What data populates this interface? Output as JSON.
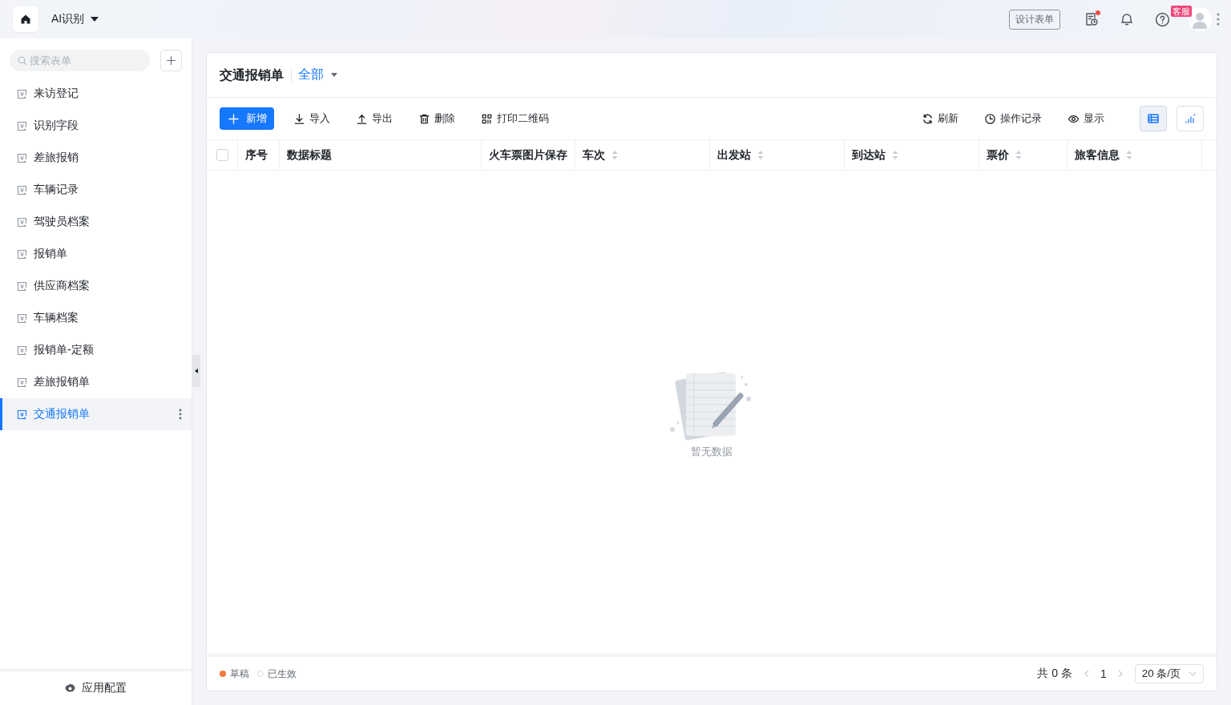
{
  "header": {
    "app_name": "AI识别",
    "design_button": "设计表单",
    "notification_dot": true,
    "support_badge": "客服"
  },
  "sidebar": {
    "search_placeholder": "搜索表单",
    "items": [
      {
        "label": "来访登记",
        "selected": false
      },
      {
        "label": "识别字段",
        "selected": false
      },
      {
        "label": "差旅报销",
        "selected": false
      },
      {
        "label": "车辆记录",
        "selected": false
      },
      {
        "label": "驾驶员档案",
        "selected": false
      },
      {
        "label": "报销单",
        "selected": false
      },
      {
        "label": "供应商档案",
        "selected": false
      },
      {
        "label": "车辆档案",
        "selected": false
      },
      {
        "label": "报销单-定额",
        "selected": false
      },
      {
        "label": "差旅报销单",
        "selected": false
      },
      {
        "label": "交通报销单",
        "selected": true
      }
    ],
    "footer": "应用配置"
  },
  "main": {
    "title": "交通报销单",
    "filter": "全部",
    "toolbar_left": [
      {
        "label": "新增",
        "kind": "add"
      },
      {
        "label": "导入",
        "kind": "import"
      },
      {
        "label": "导出",
        "kind": "export"
      },
      {
        "label": "删除",
        "kind": "delete"
      },
      {
        "label": "打印二维码",
        "kind": "qrcode"
      }
    ],
    "toolbar_right": [
      {
        "label": "刷新",
        "kind": "refresh"
      },
      {
        "label": "操作记录",
        "kind": "history"
      },
      {
        "label": "显示",
        "kind": "view"
      }
    ],
    "view_toggles": [
      {
        "kind": "table",
        "selected": true
      },
      {
        "kind": "chart",
        "selected": false
      }
    ],
    "table": {
      "select_all_checked": false,
      "columns": [
        {
          "label": "序号",
          "sortable": false
        },
        {
          "label": "数据标题",
          "sortable": false
        },
        {
          "label": "火车票图片保存",
          "sortable": false
        },
        {
          "label": "车次",
          "sortable": true
        },
        {
          "label": "出发站",
          "sortable": true
        },
        {
          "label": "到达站",
          "sortable": true
        },
        {
          "label": "票价",
          "sortable": true
        },
        {
          "label": "旅客信息",
          "sortable": true
        }
      ]
    },
    "empty_text": "暂无数据",
    "legend": [
      {
        "label": "草稿",
        "color": "#f07b3f",
        "filled": true
      },
      {
        "label": "已生效",
        "color": "#d9d9d9",
        "filled": false
      }
    ],
    "pagination": {
      "total": "共 0 条",
      "page": "1",
      "page_size": "20 条/页"
    }
  }
}
